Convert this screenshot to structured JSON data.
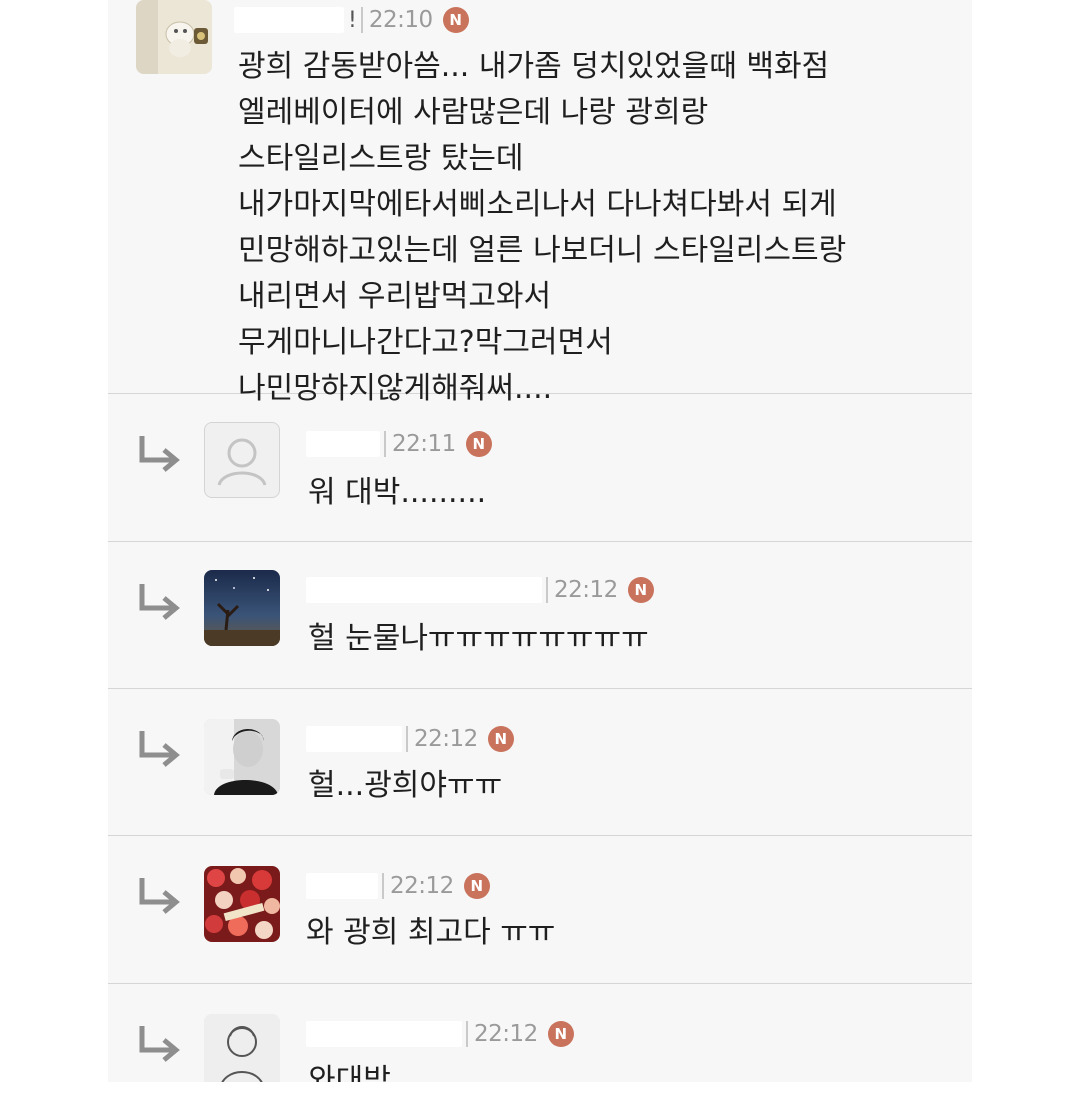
{
  "comments": [
    {
      "name_fragment": "!",
      "time": "22:10",
      "badge": "N",
      "lines": [
        "광희 감동받아씀... 내가좀 덩치있었을때 백화점",
        "엘레베이터에 사람많은데 나랑 광희랑",
        "스타일리스트랑 탔는데",
        "내가마지막에타서삐소리나서 다나쳐다봐서 되게",
        "민망해하고있는데 얼른 나보더니 스타일리스트랑",
        "내리면서 우리밥먹고와서",
        "무게마니나간다고?막그러면서",
        "나민망하지않게해줘써...."
      ]
    },
    {
      "time": "22:11",
      "badge": "N",
      "text": "워 대박........."
    },
    {
      "time": "22:12",
      "badge": "N",
      "text": "헐 눈물나ㅠㅠㅠㅠㅠㅠㅠㅠ"
    },
    {
      "time": "22:12",
      "badge": "N",
      "text": "헐...광희야ㅠㅠ"
    },
    {
      "time": "22:12",
      "badge": "N",
      "text": "와 광희 최고다 ㅠㅠ"
    },
    {
      "time": "22:12",
      "badge": "N",
      "text": "와대박"
    }
  ],
  "colors": {
    "panel_bg": "#f7f7f7",
    "divider": "#d6d6d6",
    "badge": "#c9725c",
    "time_text": "#9a9a9a",
    "body_text": "#1f1f1f"
  },
  "icons": [
    "reply-arrow-icon",
    "new-badge-icon",
    "default-avatar-icon"
  ]
}
